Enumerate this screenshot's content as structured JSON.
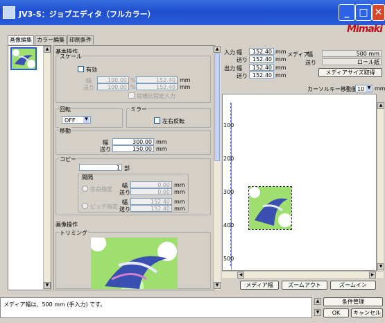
{
  "window": {
    "title": "JV3-S：ジョブエディタ（フルカラー）",
    "brand": "Mimaki"
  },
  "tabs": [
    "画像編集",
    "カラー編集",
    "印刷条件"
  ],
  "basic_ops": {
    "group_label": "基本操作",
    "scale": {
      "label": "スケール",
      "enable_label": "有効",
      "width_label": "幅",
      "feed_label": "送り",
      "width_pct": "100.00",
      "feed_pct": "100.00",
      "pct_unit": "%",
      "width_mm": "152.40",
      "feed_mm": "152.40",
      "mm_unit": "mm",
      "keep_ratio_label": "縦横比固定入力"
    },
    "rotate": {
      "label": "回転",
      "value": "OFF"
    },
    "mirror": {
      "label": "ミラー",
      "lr_label": "左右反転"
    },
    "move": {
      "label": "移動",
      "width_label": "幅",
      "feed_label": "送り",
      "width_value": "300.00",
      "feed_value": "150.00",
      "unit": "mm"
    },
    "copy": {
      "label": "コピー",
      "count": "1",
      "count_unit": "部",
      "gap_label": "間隔",
      "blank_label": "余白指定",
      "pitch_label": "ピッチ指定",
      "width_label": "幅",
      "feed_label": "送り",
      "blank_w": "0.00",
      "blank_f": "0.00",
      "pitch_w": "152.40",
      "pitch_f": "152.40",
      "unit": "mm"
    }
  },
  "image_ops": {
    "label": "画像操作",
    "trimming_label": "トリミング"
  },
  "info": {
    "input_label": "入力",
    "output_label": "出力",
    "width_label": "幅",
    "feed_label": "送り",
    "in_w": "152.40",
    "in_f": "152.40",
    "out_w": "152.40",
    "out_f": "152.40",
    "unit": "mm",
    "media_label": "メディア",
    "media_width_label": "幅",
    "media_feed_label": "送り",
    "media_width": "500 mm",
    "media_feed": "ロール紙",
    "get_media_btn": "メディアサイズ取得",
    "cursor_label": "カーソルキー移動量",
    "cursor_value": "10",
    "cursor_unit": "mm"
  },
  "ruler": {
    "top": [
      "400",
      "300",
      "200",
      "100"
    ],
    "left": [
      "100",
      "200",
      "300",
      "400",
      "500"
    ]
  },
  "canvas_buttons": {
    "media_width": "メディア幅",
    "zoom_out": "ズームアウト",
    "zoom_in": "ズームイン"
  },
  "status": {
    "message": "メディア幅は、500 mm (手入力) です。"
  },
  "bottom_buttons": {
    "conditions": "条件管理",
    "ok": "OK",
    "cancel": "キャンセル"
  }
}
